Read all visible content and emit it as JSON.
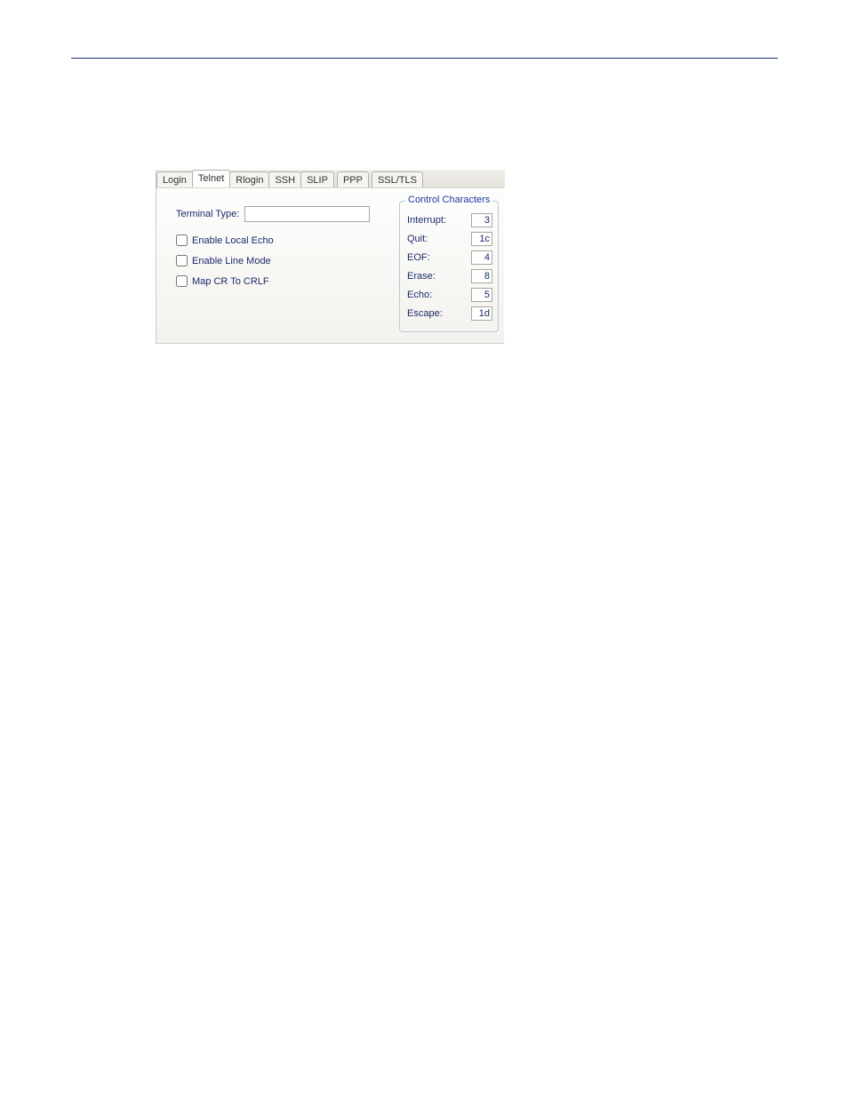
{
  "tabs": [
    {
      "label": "Login",
      "active": false
    },
    {
      "label": "Telnet",
      "active": true
    },
    {
      "label": "Rlogin",
      "active": false
    },
    {
      "label": "SSH",
      "active": false
    },
    {
      "label": "SLIP",
      "active": false
    },
    {
      "label": "PPP",
      "active": false
    },
    {
      "label": "SSL/TLS",
      "active": false
    }
  ],
  "form": {
    "terminal_type_label": "Terminal Type:",
    "terminal_type_value": "",
    "enable_local_echo_label": "Enable Local Echo",
    "enable_local_echo_checked": false,
    "enable_line_mode_label": "Enable Line Mode",
    "enable_line_mode_checked": false,
    "map_cr_label": "Map CR To CRLF",
    "map_cr_checked": false
  },
  "control_chars": {
    "legend": "Control Characters",
    "rows": [
      {
        "label": "Interrupt:",
        "value": "3"
      },
      {
        "label": "Quit:",
        "value": "1c"
      },
      {
        "label": "EOF:",
        "value": "4"
      },
      {
        "label": "Erase:",
        "value": "8"
      },
      {
        "label": "Echo:",
        "value": "5"
      },
      {
        "label": "Escape:",
        "value": "1d"
      }
    ]
  }
}
